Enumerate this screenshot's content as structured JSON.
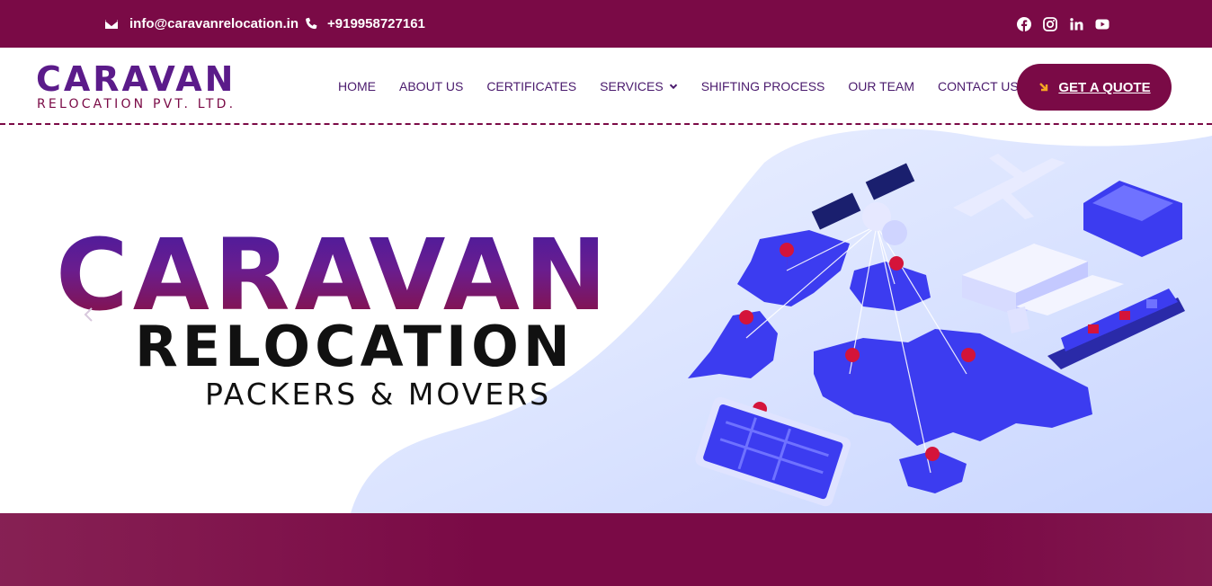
{
  "topbar": {
    "email": "info@caravanrelocation.in",
    "phone": "+919958727161",
    "icons": [
      "envelope-icon",
      "phone-icon"
    ],
    "social": [
      "facebook-icon",
      "instagram-icon",
      "linkedin-icon",
      "youtube-icon"
    ]
  },
  "header": {
    "logo": {
      "brand": "CARAVAN",
      "sub": "RELOCATION PVT. LTD."
    },
    "nav": [
      {
        "label": "HOME"
      },
      {
        "label": "ABOUT US"
      },
      {
        "label": "CERTIFICATES"
      },
      {
        "label": "SERVICES",
        "dropdown": true
      },
      {
        "label": "SHIFTING PROCESS"
      },
      {
        "label": "OUR TEAM"
      },
      {
        "label": "CONTACT US"
      }
    ],
    "cta": {
      "label": "GET A QUOTE",
      "icon": "arrow-down-right-icon"
    }
  },
  "hero": {
    "title": "CARAVAN",
    "subtitle": "RELOCATION",
    "tagline": "PACKERS & MOVERS",
    "illustration": "world-map-logistics-illustration"
  },
  "colors": {
    "brand": "#7a0a46",
    "purple": "#5b1b8a",
    "nav_text": "#4a1a6d",
    "map_blue": "#3c3cf0",
    "pin_red": "#d4143a"
  }
}
